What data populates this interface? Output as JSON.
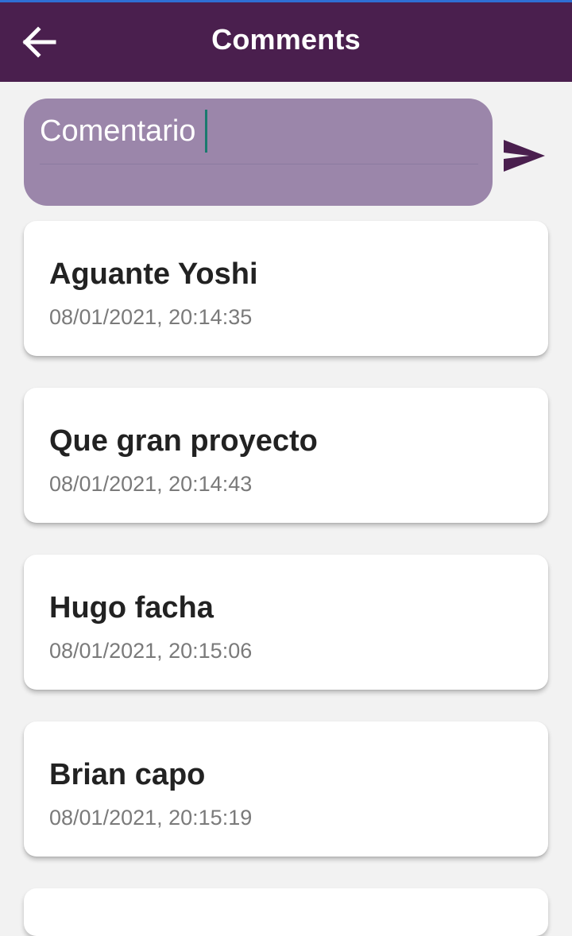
{
  "app_bar": {
    "title": "Comments",
    "back_icon": "arrow-left-icon",
    "background": "#4a1f4e"
  },
  "composer": {
    "placeholder": "Comentario",
    "value": "",
    "send_icon": "send-icon",
    "background": "#9b86aa"
  },
  "comments": [
    {
      "text": "Aguante Yoshi",
      "timestamp": "08/01/2021, 20:14:35"
    },
    {
      "text": "Que gran proyecto",
      "timestamp": "08/01/2021, 20:14:43"
    },
    {
      "text": "Hugo facha",
      "timestamp": "08/01/2021, 20:15:06"
    },
    {
      "text": "Brian capo",
      "timestamp": "08/01/2021, 20:15:19"
    }
  ]
}
